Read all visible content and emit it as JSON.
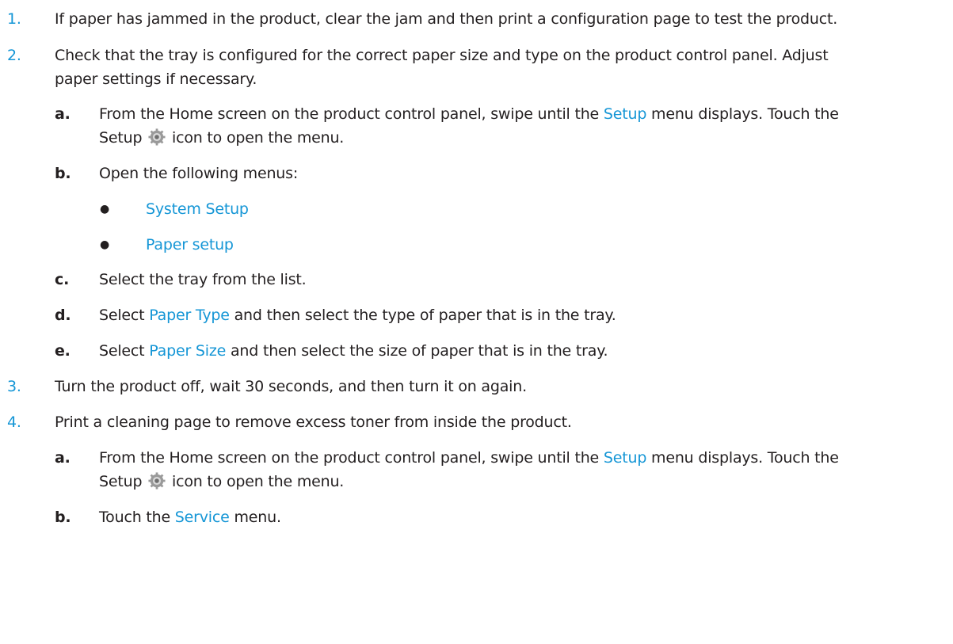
{
  "accent_color": "#1596d6",
  "steps": {
    "s1": {
      "num": "1.",
      "text": "If paper has jammed in the product, clear the jam and then print a configuration page to test the product."
    },
    "s2": {
      "num": "2.",
      "line1": "Check that the tray is configured for the correct paper size and type on the product control panel. Adjust",
      "line2": "paper settings if necessary.",
      "a": {
        "letter": "a.",
        "pre": "From the Home screen on the product control panel, swipe until the ",
        "link": "Setup",
        "post": " menu displays. Touch the",
        "line2_pre": "Setup",
        "line2_post": "icon to open the menu."
      },
      "b": {
        "letter": "b.",
        "text": "Open the following menus:"
      },
      "bullet1": "System Setup",
      "bullet2": "Paper setup",
      "c": {
        "letter": "c.",
        "text": "Select the tray from the list."
      },
      "d": {
        "letter": "d.",
        "pre": "Select ",
        "link": "Paper Type",
        "post": " and then select the type of paper that is in the tray."
      },
      "e": {
        "letter": "e.",
        "pre": "Select ",
        "link": "Paper Size",
        "post": " and then select the size of paper that is in the tray."
      }
    },
    "s3": {
      "num": "3.",
      "text": "Turn the product off, wait 30 seconds, and then turn it on again."
    },
    "s4": {
      "num": "4.",
      "text": "Print a cleaning page to remove excess toner from inside the product.",
      "a": {
        "letter": "a.",
        "pre": "From the Home screen on the product control panel, swipe until the ",
        "link": "Setup",
        "post": " menu displays. Touch the",
        "line2_pre": "Setup",
        "line2_post": "icon to open the menu."
      },
      "b": {
        "letter": "b.",
        "pre": "Touch the ",
        "link": "Service",
        "post": " menu."
      }
    }
  }
}
